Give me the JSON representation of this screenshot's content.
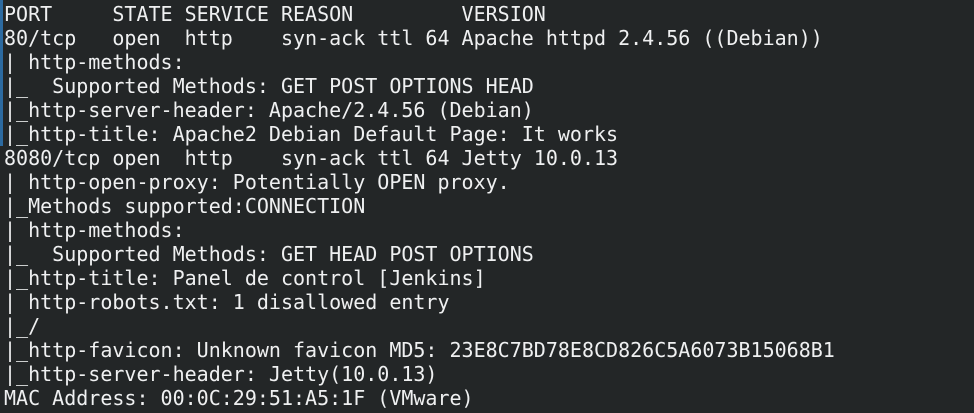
{
  "terminal": {
    "accent_color": "#2c6aa0",
    "background_color": "#232627",
    "text_color": "#eff0f1",
    "lines": [
      "PORT     STATE SERVICE REASON         VERSION",
      "80/tcp   open  http    syn-ack ttl 64 Apache httpd 2.4.56 ((Debian))",
      "| http-methods: ",
      "|_  Supported Methods: GET POST OPTIONS HEAD",
      "|_http-server-header: Apache/2.4.56 (Debian)",
      "|_http-title: Apache2 Debian Default Page: It works",
      "8080/tcp open  http    syn-ack ttl 64 Jetty 10.0.13",
      "| http-open-proxy: Potentially OPEN proxy.",
      "|_Methods supported:CONNECTION",
      "| http-methods: ",
      "|_  Supported Methods: GET HEAD POST OPTIONS",
      "|_http-title: Panel de control [Jenkins]",
      "| http-robots.txt: 1 disallowed entry ",
      "|_/",
      "|_http-favicon: Unknown favicon MD5: 23E8C7BD78E8CD826C5A6073B15068B1",
      "|_http-server-header: Jetty(10.0.13)",
      "MAC Address: 00:0C:29:51:A5:1F (VMware)"
    ]
  }
}
